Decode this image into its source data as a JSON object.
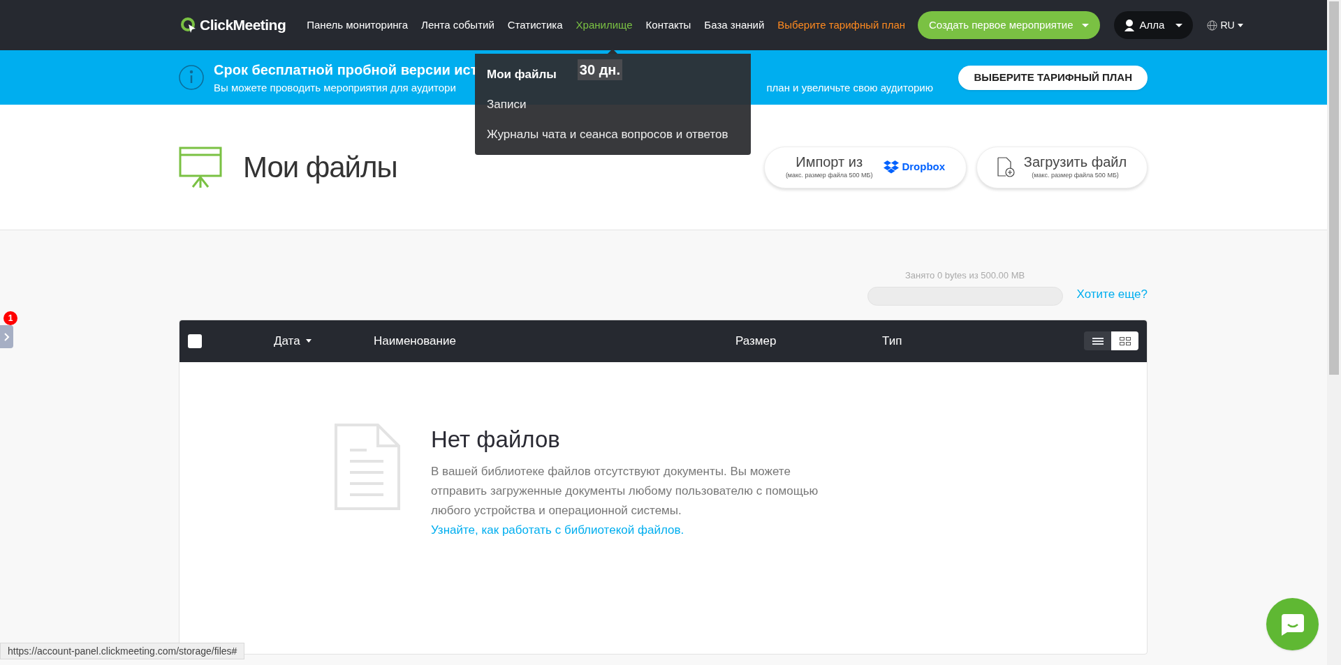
{
  "nav": {
    "logo": "ClickMeeting",
    "items": [
      {
        "label": "Панель мониторинга",
        "selected": false,
        "kind": "link"
      },
      {
        "label": "Лента событий",
        "selected": false,
        "kind": "link"
      },
      {
        "label": "Статистика",
        "selected": false,
        "kind": "link"
      },
      {
        "label": "Хранилище",
        "selected": true,
        "kind": "link"
      },
      {
        "label": "Контакты",
        "selected": false,
        "kind": "link"
      },
      {
        "label": "База знаний",
        "selected": false,
        "kind": "link"
      },
      {
        "label": "Выберите тарифный план",
        "selected": false,
        "kind": "promo"
      }
    ],
    "create_button": "Создать первое мероприятие",
    "user": "Алла",
    "language": "RU"
  },
  "storage_menu": {
    "items": [
      {
        "label": "Мои файлы",
        "selected": true
      },
      {
        "label": "Записи",
        "selected": false
      },
      {
        "label": "Журналы чата и сеанса вопросов и ответов",
        "selected": false
      }
    ]
  },
  "trial_banner": {
    "title_start": "Срок бесплатной пробной версии ист",
    "title_end": "30 дн.",
    "text_start": "Вы можете проводить мероприятия для аудитори",
    "text_end": "план и увеличьте свою аудиторию",
    "button": "ВЫБЕРИТЕ ТАРИФНЫЙ ПЛАН"
  },
  "page": {
    "title": "Мои файлы",
    "import_button": {
      "label": "Импорт из",
      "note": "(макс. размер файла 500 МБ)",
      "brand": "Dropbox"
    },
    "upload_button": {
      "label": "Загрузить файл",
      "note": "(макс. размер файла 500 МБ)"
    }
  },
  "storage": {
    "usage": "Занято 0 bytes из 500.00 MB",
    "more_link": "Хотите еще?"
  },
  "table": {
    "select_all_checked": false,
    "columns": [
      {
        "label": "Дата",
        "sorted": true
      },
      {
        "label": "Наименование",
        "sorted": false
      },
      {
        "label": "Размер",
        "sorted": false
      },
      {
        "label": "Тип",
        "sorted": false
      }
    ],
    "views": [
      {
        "kind": "list",
        "selected": true
      },
      {
        "kind": "grid",
        "selected": false
      }
    ]
  },
  "empty_state": {
    "title": "Нет файлов",
    "text": "В вашей библиотеке файлов отсутствуют документы. Вы можете отправить загруженные документы любому пользователю с помощью любого устройства и операционной системы.",
    "link": "Узнайте, как работать с библиотекой файлов."
  },
  "side_tab": {
    "badge": "1"
  },
  "status_bar": {
    "url": "https://account-panel.clickmeeting.com/storage/files#"
  }
}
